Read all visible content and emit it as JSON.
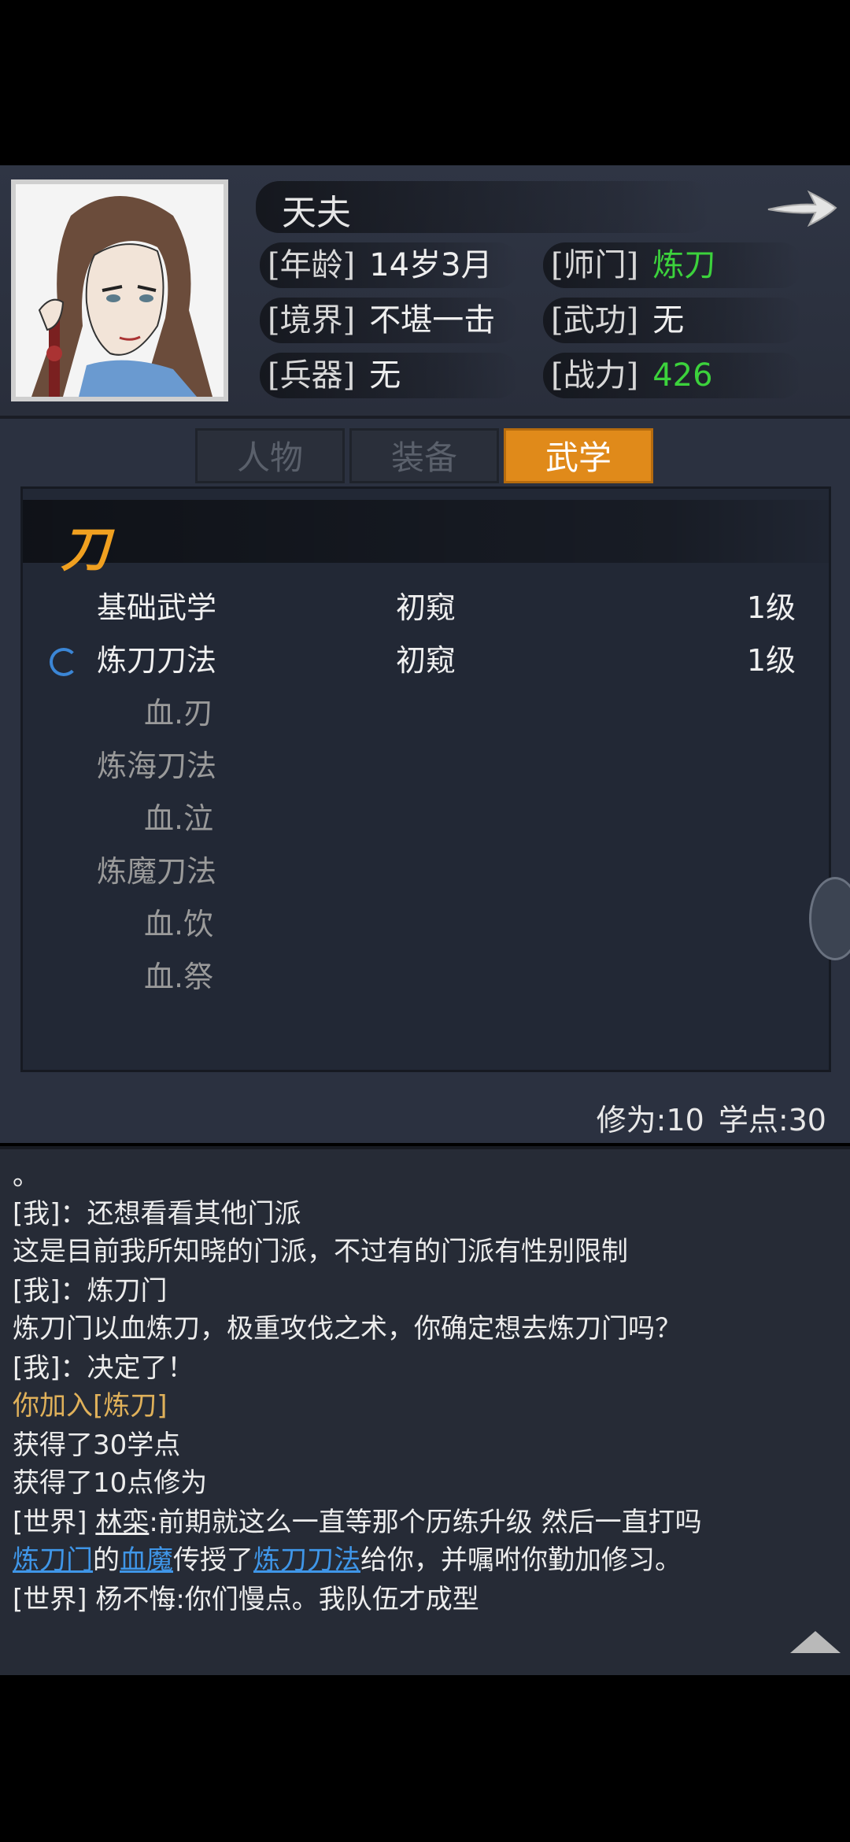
{
  "character": {
    "name": "天夫",
    "age_label": "[年龄]",
    "age_value": "14岁3月",
    "sect_label": "[师门]",
    "sect_value": "炼刀",
    "realm_label": "[境界]",
    "realm_value": "不堪一击",
    "martial_label": "[武功]",
    "martial_value": "无",
    "weapon_label": "[兵器]",
    "weapon_value": "无",
    "power_label": "[战力]",
    "power_value": "426"
  },
  "tabs": [
    {
      "label": "人物",
      "active": false
    },
    {
      "label": "装备",
      "active": false
    },
    {
      "label": "武学",
      "active": true
    }
  ],
  "skill_category": "刀",
  "skills": [
    {
      "name": "基础武学",
      "level": "初窥",
      "rank": "1级",
      "type": "main",
      "training": false
    },
    {
      "name": "炼刀刀法",
      "level": "初窥",
      "rank": "1级",
      "type": "main",
      "training": true
    },
    {
      "name": "血.刃",
      "level": "",
      "rank": "",
      "type": "sub"
    },
    {
      "name": "炼海刀法",
      "level": "",
      "rank": "",
      "type": "locked"
    },
    {
      "name": "血.泣",
      "level": "",
      "rank": "",
      "type": "sub"
    },
    {
      "name": "炼魔刀法",
      "level": "",
      "rank": "",
      "type": "locked"
    },
    {
      "name": "血.饮",
      "level": "",
      "rank": "",
      "type": "sub"
    },
    {
      "name": "血.祭",
      "level": "",
      "rank": "",
      "type": "sub"
    }
  ],
  "points": {
    "cultivation": "修为:10",
    "study": "学点:30"
  },
  "chat": {
    "lines": [
      "。",
      "[我]：还想看看其他门派",
      "这是目前我所知晓的门派，不过有的门派有性别限制",
      "[我]：炼刀门",
      "炼刀门以血炼刀，极重攻伐之术，你确定想去炼刀门吗？",
      "[我]：决定了！"
    ],
    "join_prefix": "你加入",
    "join_sect": "[炼刀]",
    "gain_lines": [
      "获得了30学点",
      "获得了10点修为"
    ],
    "world1_tag": "[世界]",
    "world1_user": "林栾",
    "world1_msg": ":前期就这么一直等那个历练升级 然后一直打吗",
    "teach_sect": "炼刀门",
    "teach_de": "的",
    "teach_master": "血魔",
    "teach_mid": "传授了",
    "teach_skill": "炼刀刀法",
    "teach_end": "给你，并嘱咐你勤加修习。",
    "world2_tag": "[世界]",
    "world2_msg": " 杨不悔:你们慢点。我队伍才成型"
  },
  "colors": {
    "accent_tab": "#e08a1a",
    "power_green": "#3cd23c",
    "link_blue": "#3f96e8",
    "gold": "#e0b15a"
  }
}
